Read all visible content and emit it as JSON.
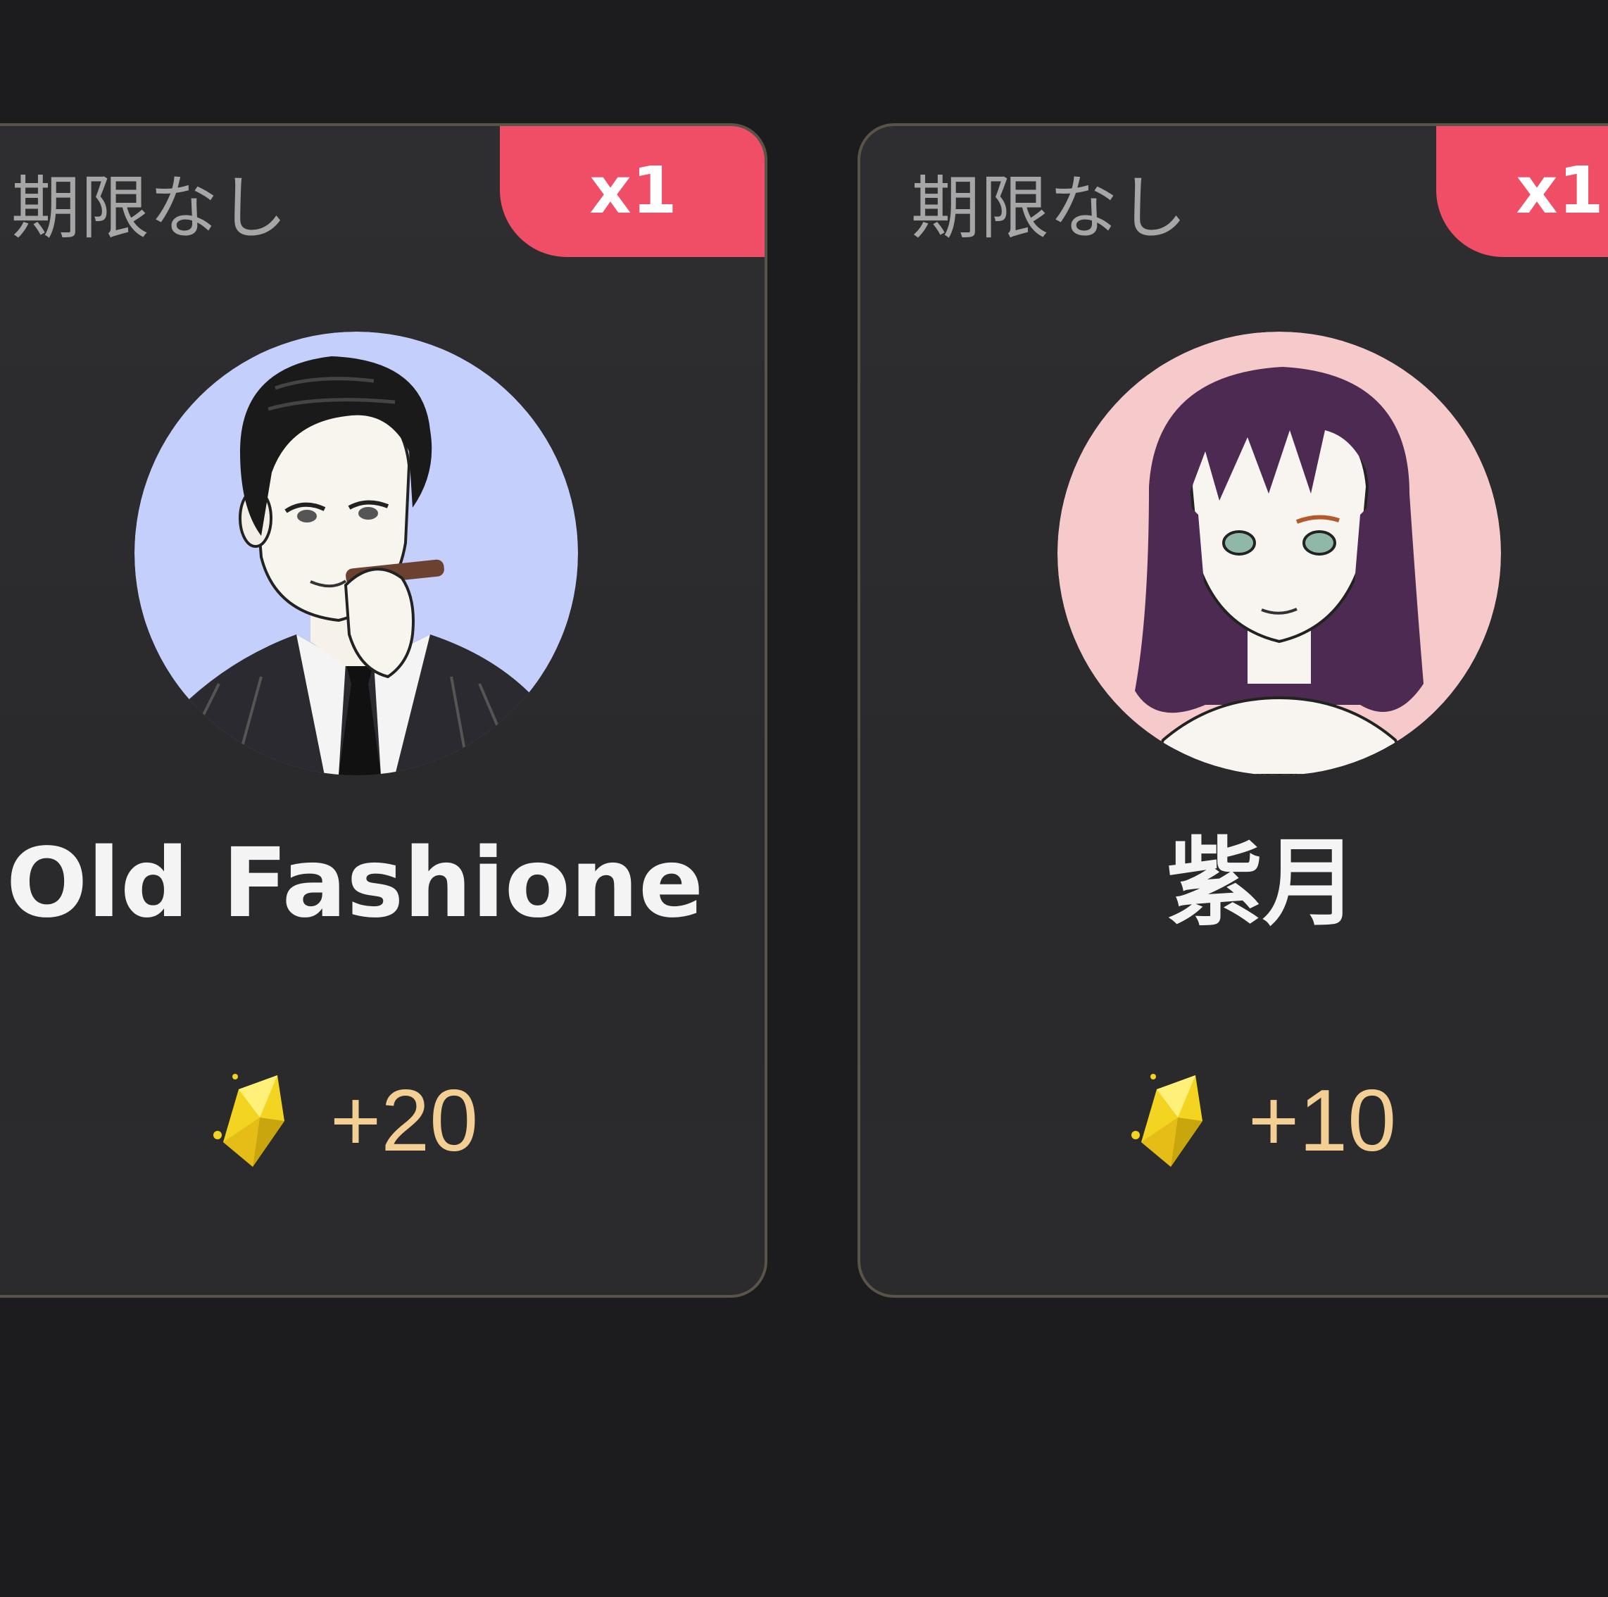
{
  "colors": {
    "background": "#1c1c1e",
    "card": "#2d2d2f",
    "card_border": "#5a5347",
    "badge": "#f04e66",
    "expiry_text": "#a6a6a6",
    "name_text": "#f4f4f4",
    "reward_text": "#f3cf93"
  },
  "cards": [
    {
      "expiry": "期限なし",
      "quantity": "x1",
      "name": "Old Fashione",
      "reward": "+20",
      "avatar_icon": "man-with-cigar-avatar",
      "avatar_bg": "#c4d0fb",
      "reward_icon": "gem-icon"
    },
    {
      "expiry": "期限なし",
      "quantity": "x1",
      "name": "紫月",
      "reward": "+10",
      "avatar_icon": "woman-purple-hair-avatar",
      "avatar_bg": "#f6c9cb",
      "reward_icon": "gem-icon"
    }
  ]
}
